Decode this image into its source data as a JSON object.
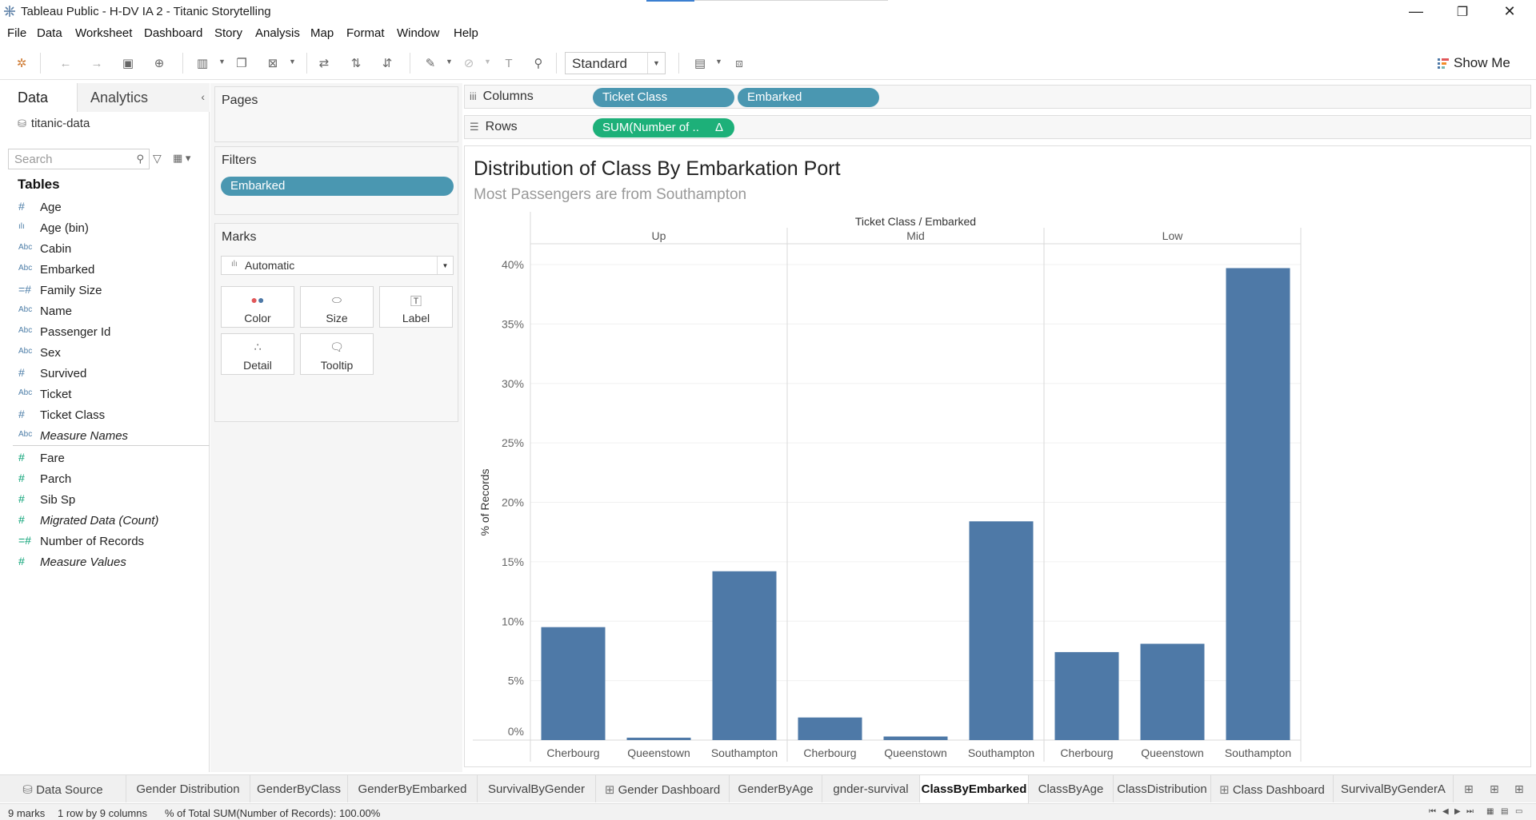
{
  "window": {
    "title": "Tableau Public - H-DV IA 2 - Titanic Storytelling",
    "minimize_glyph": "—",
    "restore_glyph": "❐",
    "close_glyph": "✕"
  },
  "menu": [
    "File",
    "Data",
    "Worksheet",
    "Dashboard",
    "Story",
    "Analysis",
    "Map",
    "Format",
    "Window",
    "Help"
  ],
  "toolbar": {
    "fit_select": "Standard",
    "show_me_label": "Show Me"
  },
  "data_pane": {
    "tab_data": "Data",
    "tab_analytics": "Analytics",
    "datasource": "titanic-data",
    "search_placeholder": "Search",
    "tables_heading": "Tables",
    "dimensions": [
      {
        "type": "#",
        "name": "Age",
        "italic": false
      },
      {
        "type": "ılı",
        "name": "Age (bin)",
        "italic": false
      },
      {
        "type": "Abc",
        "name": "Cabin",
        "italic": false
      },
      {
        "type": "Abc",
        "name": "Embarked",
        "italic": false
      },
      {
        "type": "=#",
        "name": "Family Size",
        "italic": false
      },
      {
        "type": "Abc",
        "name": "Name",
        "italic": false
      },
      {
        "type": "Abc",
        "name": "Passenger Id",
        "italic": false
      },
      {
        "type": "Abc",
        "name": "Sex",
        "italic": false
      },
      {
        "type": "#",
        "name": "Survived",
        "italic": false
      },
      {
        "type": "Abc",
        "name": "Ticket",
        "italic": false
      },
      {
        "type": "#",
        "name": "Ticket Class",
        "italic": false
      },
      {
        "type": "Abc",
        "name": "Measure Names",
        "italic": true
      }
    ],
    "measures": [
      {
        "type": "#",
        "name": "Fare",
        "italic": false
      },
      {
        "type": "#",
        "name": "Parch",
        "italic": false
      },
      {
        "type": "#",
        "name": "Sib Sp",
        "italic": false
      },
      {
        "type": "#",
        "name": "Migrated Data (Count)",
        "italic": true
      },
      {
        "type": "=#",
        "name": "Number of Records",
        "italic": false
      },
      {
        "type": "#",
        "name": "Measure Values",
        "italic": true
      }
    ]
  },
  "cards": {
    "pages_title": "Pages",
    "filters_title": "Filters",
    "filter_pill": "Embarked",
    "marks_title": "Marks",
    "marks_type": "Automatic",
    "mark_buttons": [
      "Color",
      "Size",
      "Label",
      "Detail",
      "Tooltip"
    ]
  },
  "shelves": {
    "columns_label": "Columns",
    "rows_label": "Rows",
    "column_pills": [
      "Ticket Class",
      "Embarked"
    ],
    "row_pill": "SUM(Number of ..",
    "row_pill_delta": "Δ"
  },
  "view": {
    "title": "Distribution of Class By Embarkation Port",
    "subtitle": "Most Passengers are from Southampton",
    "bar_color": "#4e79a7"
  },
  "chart_data": {
    "type": "bar",
    "header": "Ticket Class / Embarked",
    "ylabel": "% of Records",
    "ylim": [
      0,
      40
    ],
    "yticks": [
      "0%",
      "5%",
      "10%",
      "15%",
      "20%",
      "25%",
      "30%",
      "35%",
      "40%"
    ],
    "groups": [
      {
        "name": "Up",
        "categories": [
          "Cherbourg",
          "Queenstown",
          "Southampton"
        ],
        "values": [
          9.5,
          0.2,
          14.2
        ]
      },
      {
        "name": "Mid",
        "categories": [
          "Cherbourg",
          "Queenstown",
          "Southampton"
        ],
        "values": [
          1.9,
          0.3,
          18.4
        ]
      },
      {
        "name": "Low",
        "categories": [
          "Cherbourg",
          "Queenstown",
          "Southampton"
        ],
        "values": [
          7.4,
          8.1,
          39.7
        ]
      }
    ]
  },
  "sheet_tabs": [
    "Data Source",
    "Gender Distribution",
    "GenderByClass",
    "GenderByEmbarked",
    "SurvivalByGender",
    "Gender Dashboard",
    "GenderByAge",
    "gnder-survival",
    "ClassByEmbarked",
    "ClassByAge",
    "ClassDistribution",
    "Class Dashboard",
    "SurvivalByGenderA"
  ],
  "active_tab": "ClassByEmbarked",
  "status": {
    "marks": "9 marks",
    "rows_cols": "1 row by 9 columns",
    "summary": "% of Total SUM(Number of Records): 100.00%"
  }
}
